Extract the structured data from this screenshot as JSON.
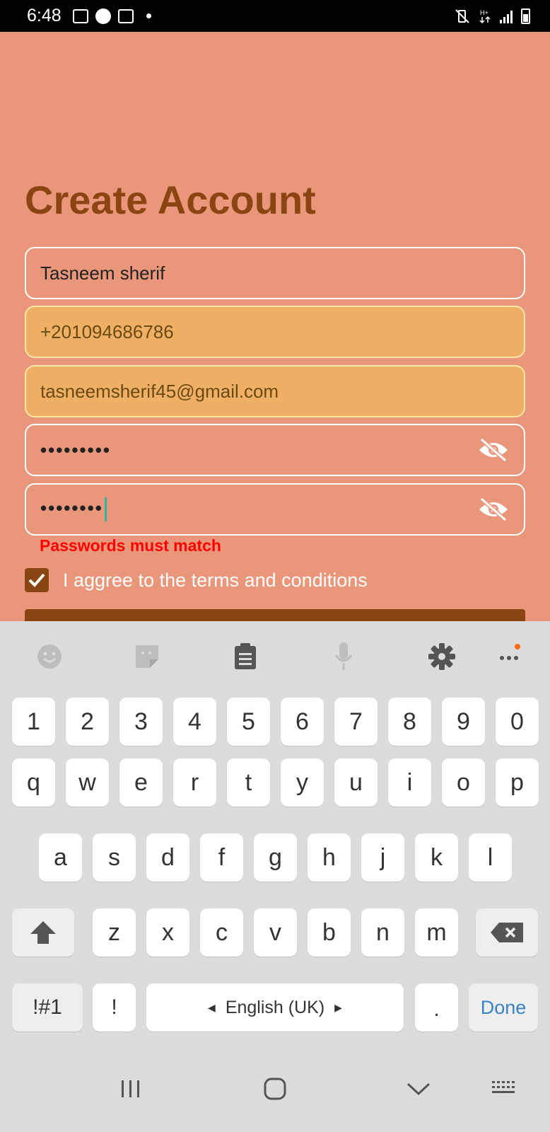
{
  "status_bar": {
    "time": "6:48"
  },
  "form": {
    "title": "Create Account",
    "name_value": "Tasneem sherif",
    "phone_value": "+201094686786",
    "email_value": "tasneemsherif45@gmail.com",
    "password_value": "•••••••••",
    "confirm_password_value": "••••••••",
    "error_text": "Passwords must match",
    "terms_label": "I aggree to the terms and conditions",
    "terms_checked": true
  },
  "colors": {
    "background": "#e9967a",
    "accent": "#8b4513",
    "autofill": "#efb066",
    "error": "#ff0000"
  },
  "keyboard": {
    "toolbar_icons": [
      "emoji-icon",
      "sticker-icon",
      "clipboard-icon",
      "microphone-icon",
      "gear-icon",
      "more-icon"
    ],
    "number_row": [
      "1",
      "2",
      "3",
      "4",
      "5",
      "6",
      "7",
      "8",
      "9",
      "0"
    ],
    "row1": [
      "q",
      "w",
      "e",
      "r",
      "t",
      "y",
      "u",
      "i",
      "o",
      "p"
    ],
    "row2": [
      "a",
      "s",
      "d",
      "f",
      "g",
      "h",
      "j",
      "k",
      "l"
    ],
    "row3": [
      "z",
      "x",
      "c",
      "v",
      "b",
      "n",
      "m"
    ],
    "symbols_label": "!#1",
    "exclaim_label": "!",
    "space_label": "English (UK)",
    "period_label": ".",
    "done_label": "Done"
  }
}
